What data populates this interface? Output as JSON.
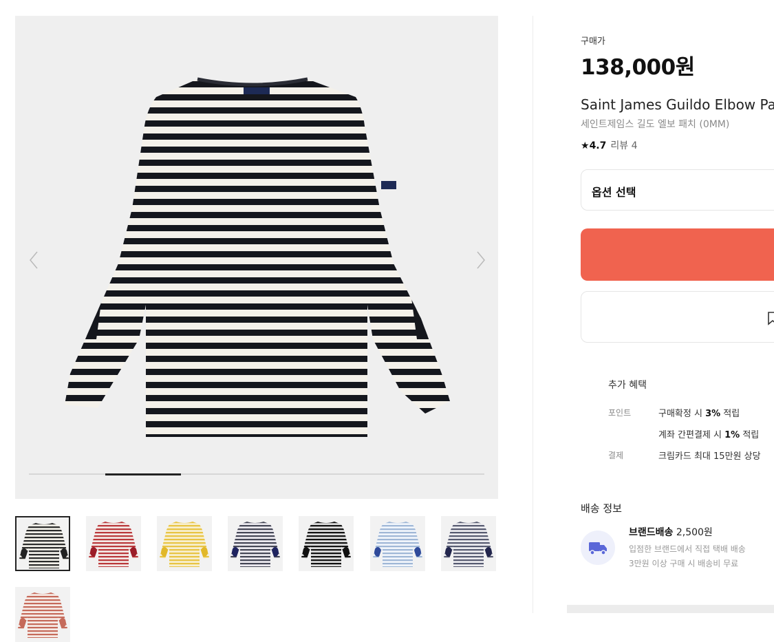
{
  "product": {
    "price_label": "구매가",
    "price": "138,000원",
    "name": "Saint James Guildo Elbow Pa",
    "subname": "세인트제임스 길도 엘보 패치 (0MM)",
    "rating_star": "★",
    "rating_score": "4.7",
    "review_count": "리뷰 4"
  },
  "option_select": {
    "label": "옵션 선택"
  },
  "gallery": {
    "progress": 0.167,
    "active_index": 2,
    "total": 6
  },
  "thumbnails": [
    {
      "color": "#3a3a3a",
      "stripe": "#2a2a2a",
      "patch": "#222"
    },
    {
      "color": "#f3e8e5",
      "stripe": "#b9373a",
      "patch": "#9b1e29"
    },
    {
      "color": "#f7efcf",
      "stripe": "#e8c444",
      "patch": "#e1b82a"
    },
    {
      "color": "#eceaf0",
      "stripe": "#444655",
      "patch": "#1f2460"
    },
    {
      "color": "#dddddd",
      "stripe": "#111111",
      "patch": "#111"
    },
    {
      "color": "#f0f5fb",
      "stripe": "#9fb7d6",
      "patch": "#2f4a9a"
    },
    {
      "color": "#ececf0",
      "stripe": "#565a70",
      "patch": "#23264d"
    },
    {
      "color": "#f6ebe6",
      "stripe": "#c56a5a",
      "patch": "#c56a5a"
    }
  ],
  "benefits": {
    "title": "추가 혜택",
    "point_label": "포인트",
    "point_1_pre": "구매확정 시 ",
    "point_1_bold": "3%",
    "point_1_post": " 적립",
    "point_2_pre": "계좌 간편결제 시 ",
    "point_2_bold": "1%",
    "point_2_post": " 적립",
    "pay_label": "결제",
    "pay_1": "크림카드 최대 15만원 상당"
  },
  "shipping": {
    "title": "배송 정보",
    "head_bold": "브랜드배송",
    "head_price": " 2,500원",
    "desc_1": "입점한 브랜드에서 직접 택배 배송",
    "desc_2": "3만원 이상 구매 시 배송비 무료"
  },
  "colors": {
    "accent": "#f0634f",
    "truck": "#5a67d8"
  }
}
